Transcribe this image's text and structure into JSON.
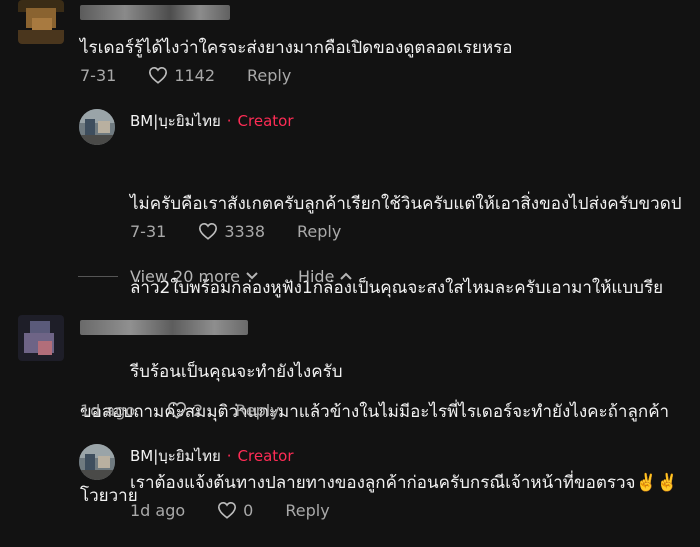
{
  "comments": [
    {
      "text": "ไรเดอร์รู้ได้ไงว่าใครจะส่งยางมากคือเปิดของดูตลอดเรยหรอ",
      "date": "7-31",
      "likes": "1142",
      "reply_label": "Reply",
      "reply": {
        "author": "BM|บฺะยิมไทย",
        "badge_separator": "·",
        "badge": "Creator",
        "text_lines": [
          "ไม่ครับคือเราสังเกตครับลูกค้าเรียกใช้วินครับแต่ให้เอาสิ่งของไปส่งครับขวดป",
          "ล่าว2ใบพร้อมกล่องหูฟัง1กล่องเป็นคุณจะสงใสไหมละครับเอามาให้แบบรีย",
          "รีบร้อนเป็นคุณจะทำยังไงครับ"
        ],
        "date": "7-31",
        "likes": "3338",
        "reply_label": "Reply"
      },
      "view_more": "View 20 more",
      "hide": "Hide"
    },
    {
      "text_lines": [
        "ขอสอบถามค่ะสมมุติว่าแกะมาแล้วข้างในไม่มีอะไรพี่ไรเดอร์จะทำยังไงคะถ้าลูกค้า",
        "โวยวาย"
      ],
      "date": "1d ago",
      "likes": "2",
      "reply_label": "Reply",
      "reply": {
        "author": "BM|บฺะยิมไทย",
        "badge_separator": "·",
        "badge": "Creator",
        "text": "เราต้องแจ้งต้นทางปลายทางของลูกค้าก่อนครับกรณีเจ้าหน้าที่ขอตรวจ✌️✌️",
        "date": "1d ago",
        "likes": "0",
        "reply_label": "Reply"
      }
    }
  ],
  "colors": {
    "background": "#121212",
    "creator_badge": "#fe2c55",
    "muted": "#a9a9a9"
  },
  "icons": [
    "heart-outline-icon",
    "chevron-down-icon",
    "chevron-up-icon"
  ]
}
